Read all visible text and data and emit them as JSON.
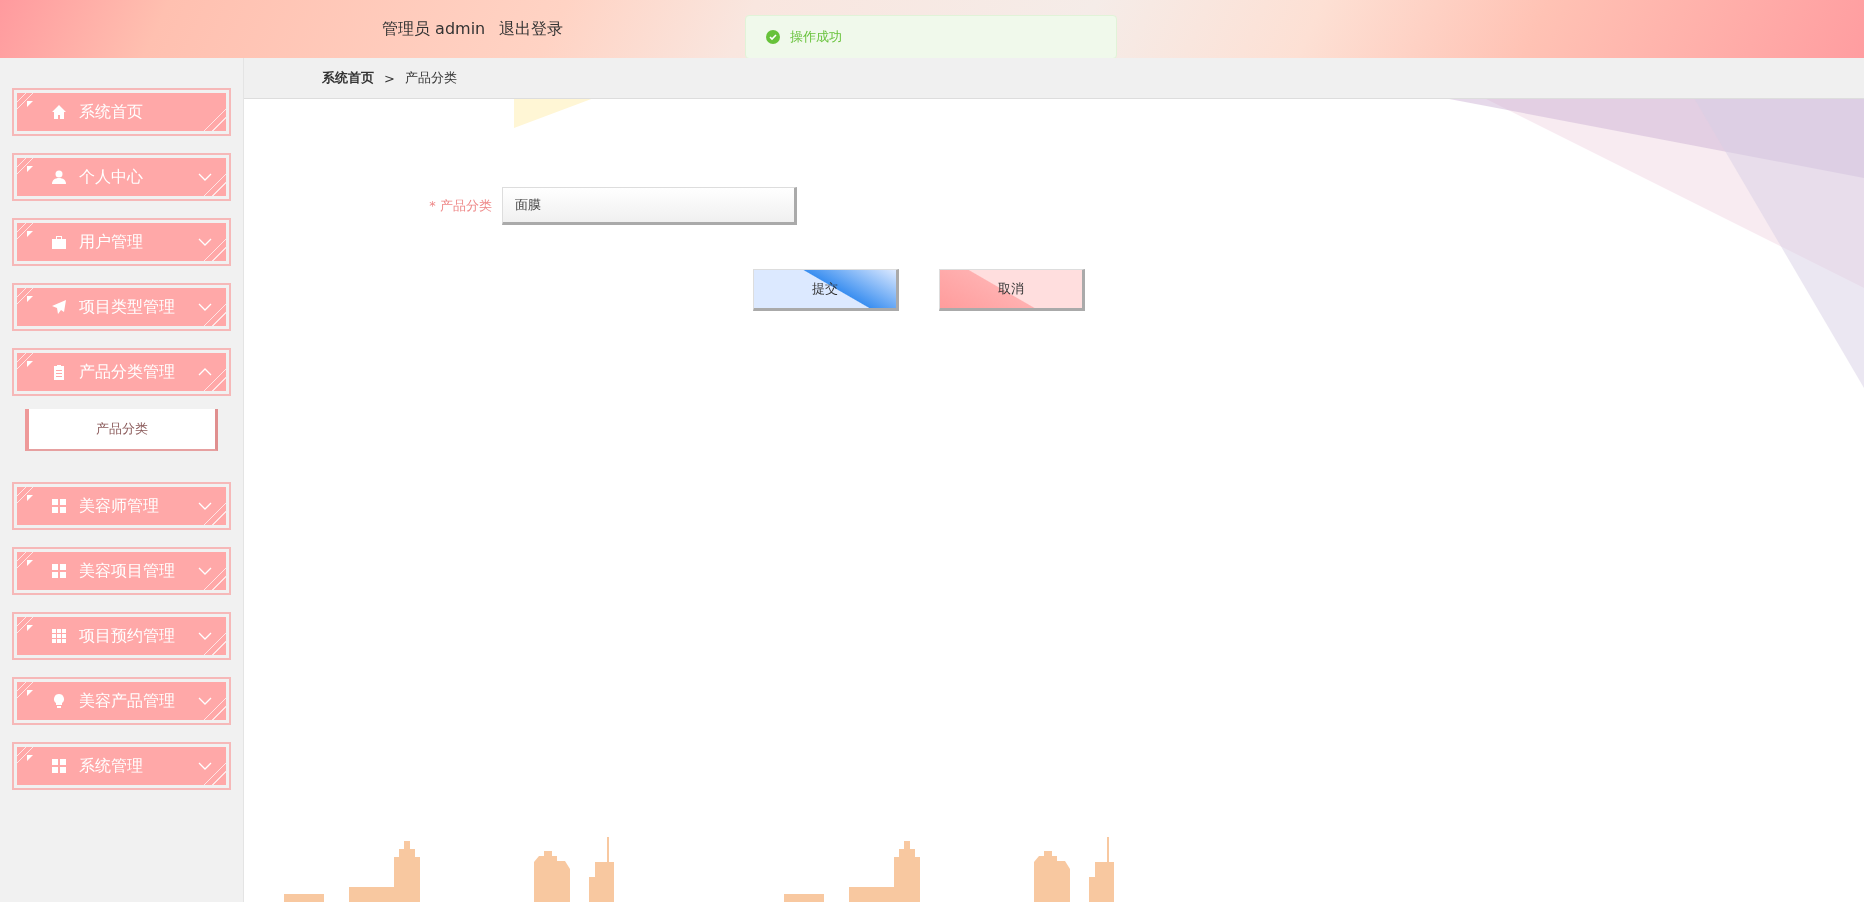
{
  "header": {
    "user_label": "管理员 admin",
    "logout": "退出登录"
  },
  "toast": {
    "message": "操作成功"
  },
  "sidebar": {
    "items": [
      {
        "label": "系统首页",
        "kind": "link"
      },
      {
        "label": "个人中心",
        "kind": "menu",
        "expanded": false
      },
      {
        "label": "用户管理",
        "kind": "menu",
        "expanded": false
      },
      {
        "label": "项目类型管理",
        "kind": "menu",
        "expanded": false
      },
      {
        "label": "产品分类管理",
        "kind": "menu",
        "expanded": true,
        "children": [
          {
            "label": "产品分类",
            "selected": true
          }
        ]
      },
      {
        "label": "美容师管理",
        "kind": "menu",
        "expanded": false
      },
      {
        "label": "美容项目管理",
        "kind": "menu",
        "expanded": false
      },
      {
        "label": "项目预约管理",
        "kind": "menu",
        "expanded": false
      },
      {
        "label": "美容产品管理",
        "kind": "menu",
        "expanded": false
      },
      {
        "label": "系统管理",
        "kind": "menu",
        "expanded": false
      }
    ]
  },
  "breadcrumb": [
    "系统首页",
    "产品分类"
  ],
  "breadcrumb_separator": ">",
  "form": {
    "fields": [
      {
        "required_mark": "*",
        "label": "产品分类",
        "value": "面膜"
      }
    ],
    "buttons": [
      {
        "label": "提交",
        "kind": "primary"
      },
      {
        "label": "取消",
        "kind": "cancel"
      }
    ]
  }
}
